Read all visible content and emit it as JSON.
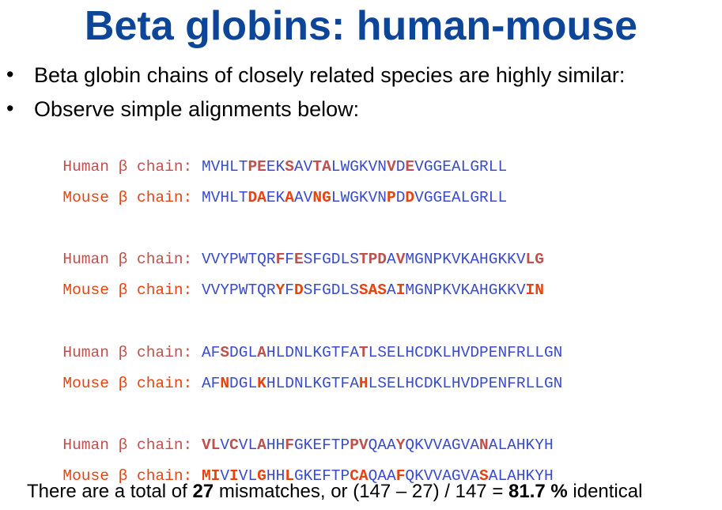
{
  "title": "Beta globins: human-mouse",
  "bullets": [
    "Beta globin chains of closely related species are highly similar:",
    "Observe simple alignments below:"
  ],
  "bullet_symbol": "•",
  "colors": {
    "title": "#0d4598",
    "human_label": "#c0504d",
    "mouse_label": "#e8420f",
    "sequence": "#3a4ccc"
  },
  "alignments": [
    {
      "human_label": "Human β chain:",
      "human_seq": "MVHLTPEEKSAVTALWGKVNVDEVGGEALGRLL",
      "mouse_label": "Mouse β chain:",
      "mouse_seq": "MVHLTDAEKAAVNGLWGKVNPDDVGGEALGRLL"
    },
    {
      "human_label": "Human β chain:",
      "human_seq": "VVYPWTQRFFESFGDLSTPDAVMGNPKVKAHGKKVLG",
      "mouse_label": "Mouse β chain:",
      "mouse_seq": "VVYPWTQRYFDSFGDLSSASAIMGNPKVKAHGKKVIN"
    },
    {
      "human_label": "Human β chain:",
      "human_seq": "AFSDGLAHLDNLKGTFATLSELHCDKLHVDPENFRLLGN",
      "mouse_label": "Mouse β chain:",
      "mouse_seq": "AFNDGLKHLDNLKGTFAHLSELHCDKLHVDPENFRLLGN"
    },
    {
      "human_label": "Human β chain:",
      "human_seq": "VLVCVLAHHFGKEFTPPVQAAYQKVVAGVANALAHKYH",
      "mouse_label": "Mouse β chain:",
      "mouse_seq": "MIVIVLGHHLGKEFTPCAQAAFQKVVAGVASALAHKYH"
    }
  ],
  "footer": {
    "prefix": "There are a total of ",
    "mismatches": "27",
    "middle": " mismatches, or (147 – 27) / 147 = ",
    "identity": "81.7 %",
    "suffix": " identical"
  }
}
